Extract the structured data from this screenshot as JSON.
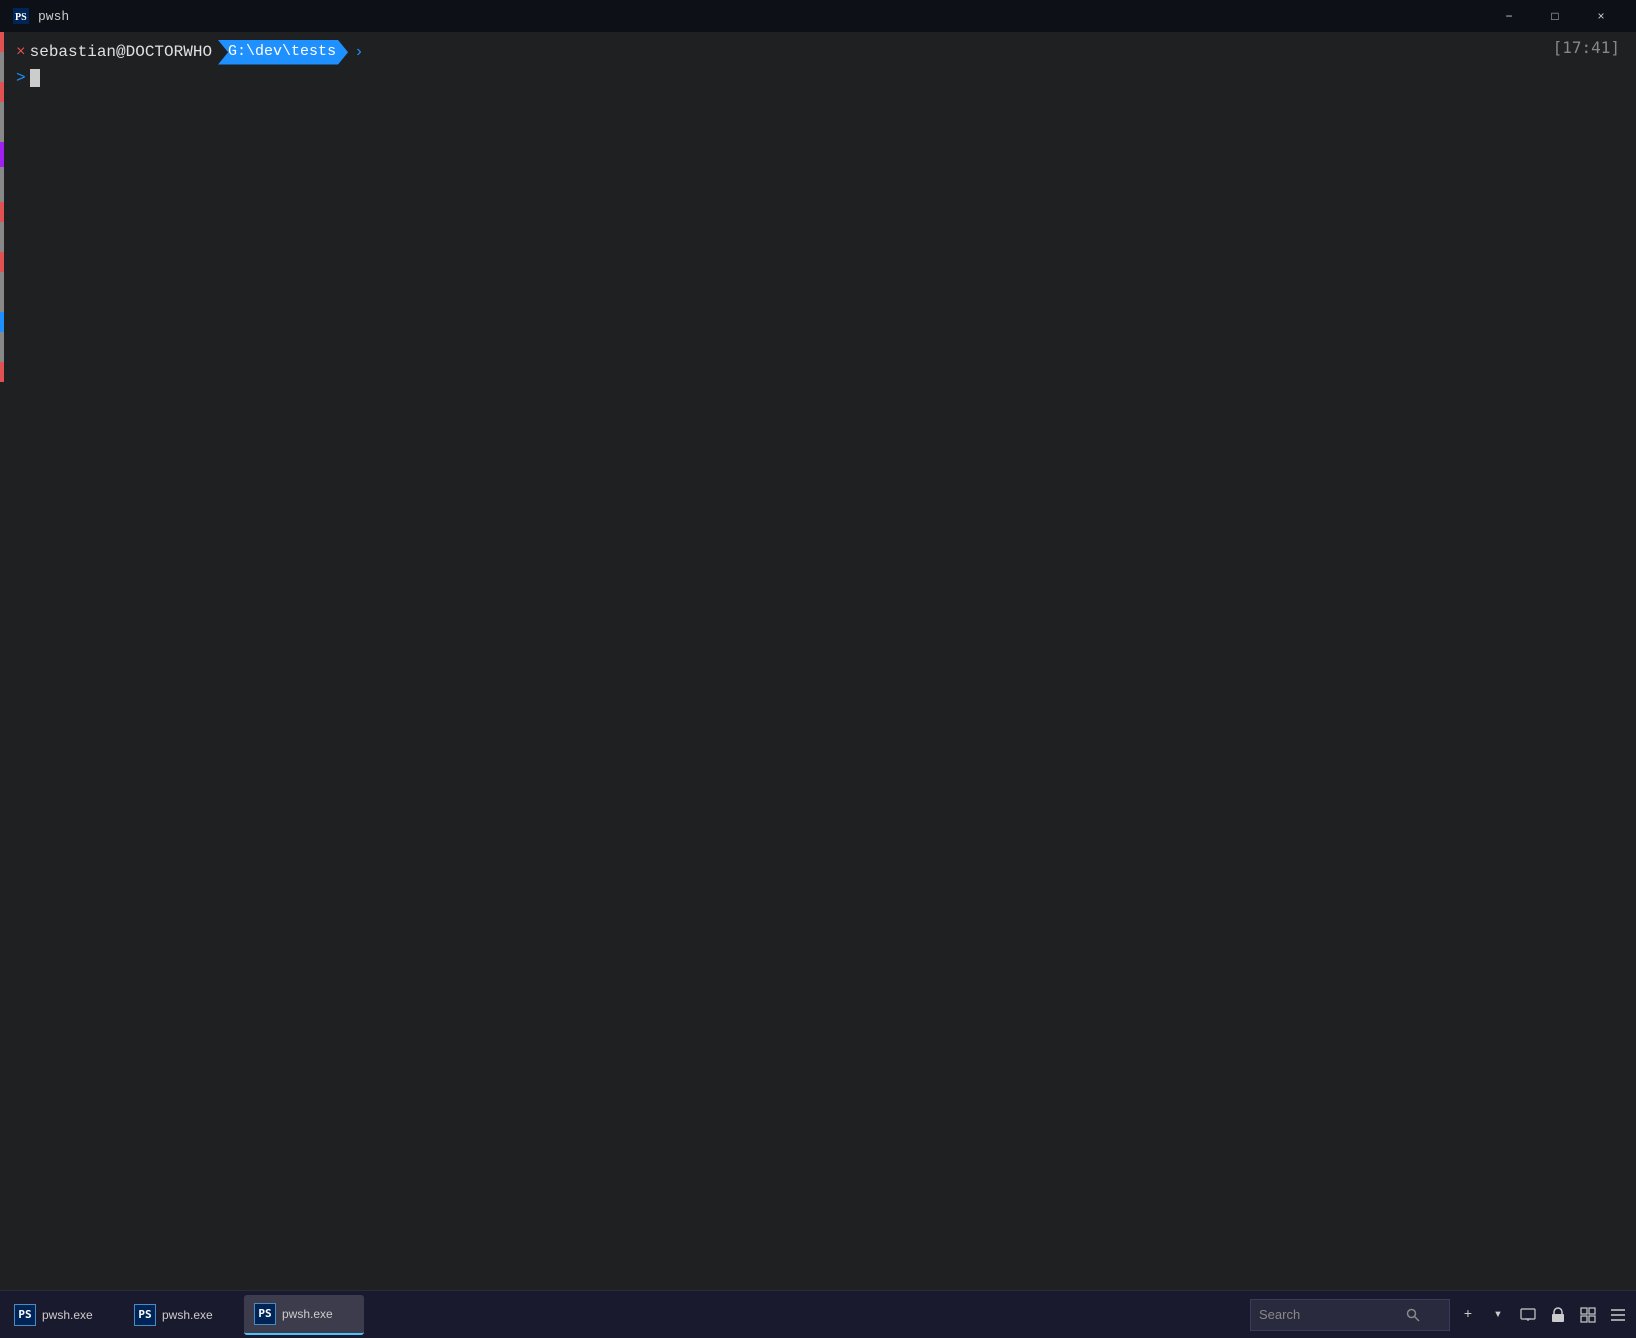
{
  "titlebar": {
    "title": "pwsh",
    "icon": "terminal-icon",
    "minimize_label": "−",
    "maximize_label": "□",
    "close_label": "×"
  },
  "terminal": {
    "user_host": "sebastian@DOCTORWHO",
    "path": "G:\\dev\\tests",
    "prompt_symbol": ">",
    "cursor_chevron": ">",
    "time": "[17:41]",
    "x_mark": "×"
  },
  "taskbar": {
    "items": [
      {
        "id": "pwsh1",
        "label": "pwsh.exe",
        "active": false
      },
      {
        "id": "pwsh2",
        "label": "pwsh.exe",
        "active": false
      },
      {
        "id": "pwsh3",
        "label": "pwsh.exe",
        "active": true
      }
    ],
    "search": {
      "placeholder": "Search",
      "value": ""
    },
    "right_icons": [
      {
        "id": "add-icon",
        "symbol": "+"
      },
      {
        "id": "dropdown-icon",
        "symbol": "▾"
      },
      {
        "id": "monitor-icon",
        "symbol": "▣"
      },
      {
        "id": "lock-icon",
        "symbol": "🔒"
      },
      {
        "id": "window-icon",
        "symbol": "⊞"
      },
      {
        "id": "menu-icon",
        "symbol": "≡"
      }
    ]
  }
}
